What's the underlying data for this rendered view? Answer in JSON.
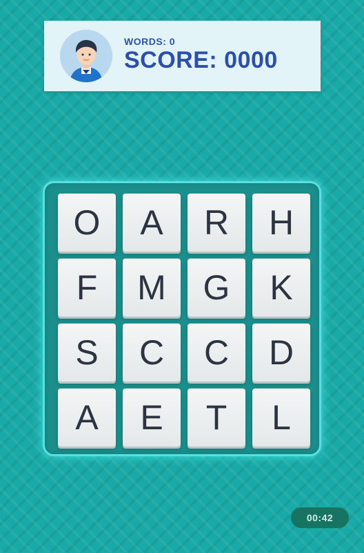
{
  "header": {
    "words_label": "WORDS: 0",
    "score_label": "SCORE: 0000",
    "avatar_icon": "player-avatar-icon"
  },
  "board": {
    "rows": [
      [
        "O",
        "A",
        "R",
        "H"
      ],
      [
        "F",
        "M",
        "G",
        "K"
      ],
      [
        "S",
        "C",
        "C",
        "D"
      ],
      [
        "A",
        "E",
        "T",
        "L"
      ]
    ]
  },
  "timer": {
    "value": "00:42"
  },
  "colors": {
    "background": "#19a9a6",
    "board": "#1a8f8c",
    "board_glow": "#58e0e0",
    "tile": "#f0f3f3",
    "score_text": "#2c4fae",
    "timer_bg": "#187462"
  }
}
